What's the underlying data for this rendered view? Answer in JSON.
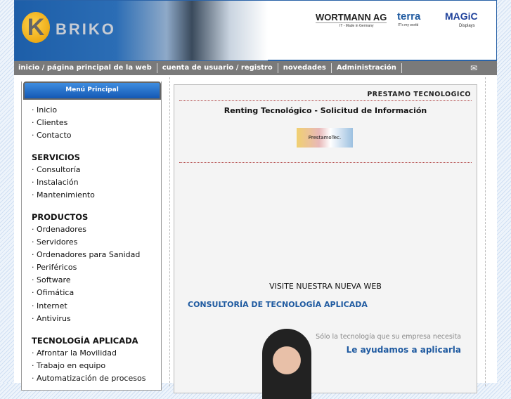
{
  "header": {
    "logo_text": "BRIKO",
    "partners": {
      "wortmann": "WORTMANN AG",
      "wortmann_tag": "IT - Made in Germany",
      "terra": "terra",
      "terra_tag": "IT's my world",
      "magic": "MAGiC",
      "magic_tag": "Displays"
    }
  },
  "nav": {
    "items": [
      "inicio / página principal de la web",
      "cuenta de usuario / registro",
      "novedades",
      "Administración"
    ],
    "mail_icon": "✉"
  },
  "sidebar": {
    "title": "Menú Principal",
    "main": [
      "Inicio",
      "Clientes",
      "Contacto"
    ],
    "servicios": {
      "head": "SERVICIOS",
      "items": [
        "Consultoría",
        "Instalación",
        "Mantenimiento"
      ]
    },
    "productos": {
      "head": "PRODUCTOS",
      "items": [
        "Ordenadores",
        "Servidores",
        "Ordenadores para Sanidad",
        "Periféricos",
        "Software",
        "Ofimática",
        "Internet",
        "Antivirus"
      ]
    },
    "tecnologia": {
      "head": "TECNOLOGÍA APLICADA",
      "items": [
        "Afrontar la Movilidad",
        "Trabajo en equipo",
        "Automatización de procesos"
      ]
    }
  },
  "main": {
    "box_title": "PRESTAMO TECNOLOGICO",
    "heading": "Renting Tecnológico - Solicitud de Información",
    "thumb_text": "PrestamoTec.",
    "visite": "VISITE NUESTRA NUEVA WEB",
    "banner": {
      "title": "CONSULTORÍA DE TECNOLOGÍA APLICADA",
      "subtitle": "Sólo la tecnología que su empresa necesita",
      "slogan": "Le ayudamos a aplicarla"
    }
  }
}
